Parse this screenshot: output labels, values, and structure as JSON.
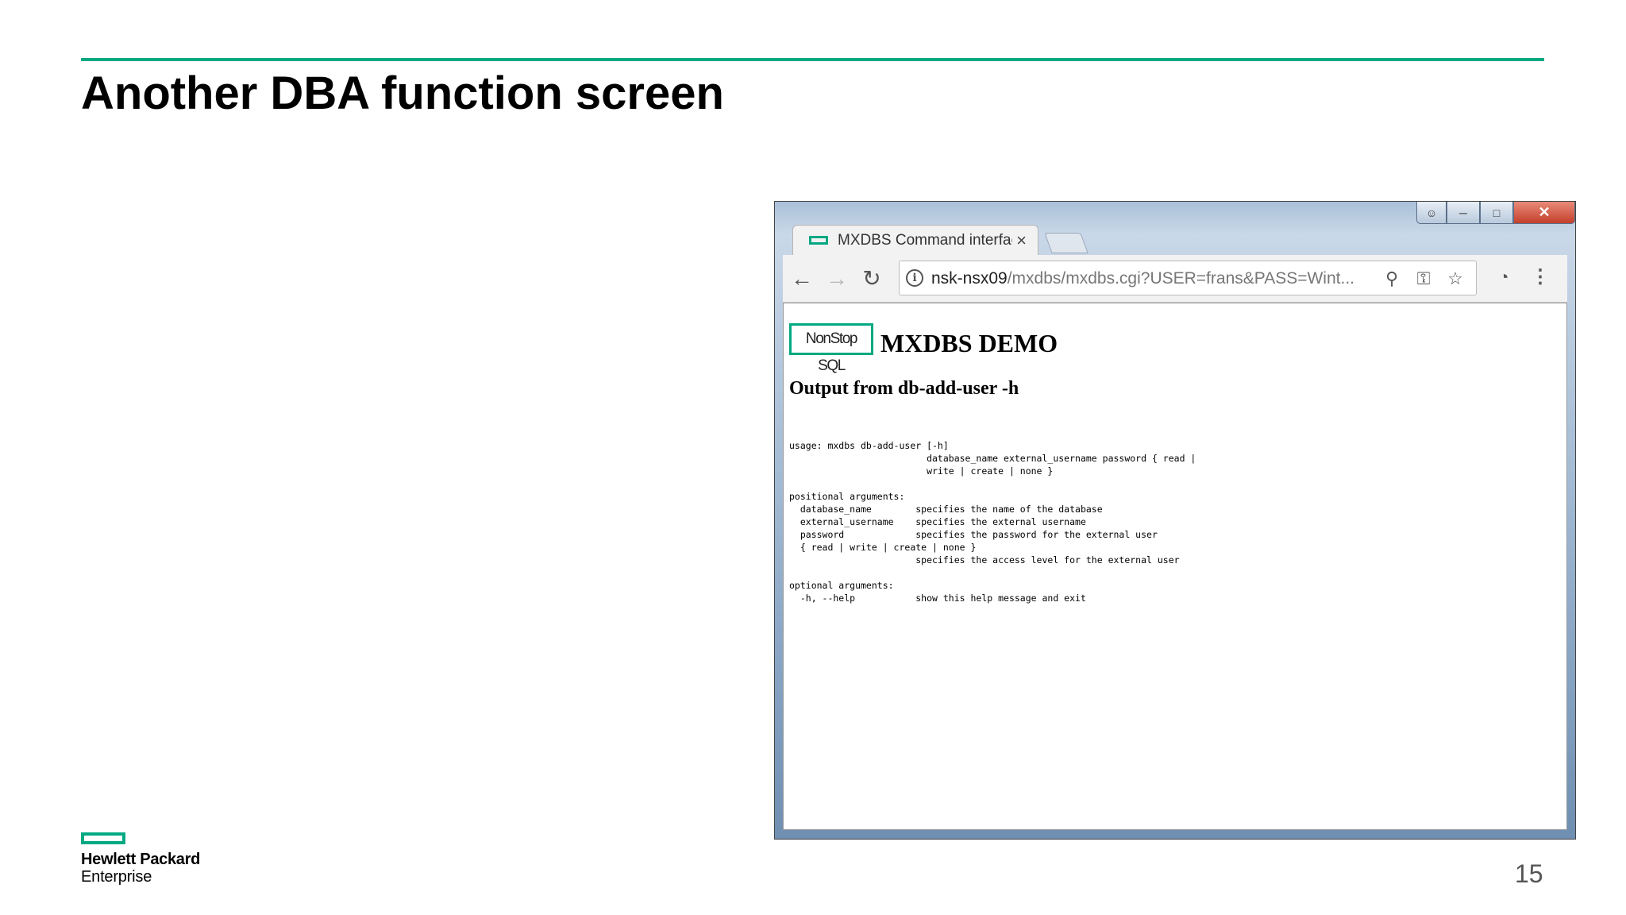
{
  "slide": {
    "title": "Another DBA function screen",
    "page_number": "15",
    "brand": {
      "line1": "Hewlett Packard",
      "line2": "Enterprise"
    },
    "accent_color": "#01a982"
  },
  "browser": {
    "tab": {
      "title": "MXDBS Command interface",
      "close_symbol": "×"
    },
    "url": {
      "host": "nsk-nsx09",
      "path": "/mxdbs/mxdbs.cgi?USER=frans&PASS=Wint..."
    },
    "icons": {
      "back": "back-arrow-icon",
      "forward": "forward-arrow-icon",
      "reload": "reload-icon",
      "info": "info-icon",
      "zoom": "zoom-icon",
      "key": "key-icon",
      "star": "star-icon",
      "performance": "speedometer-icon",
      "menu": "kebab-menu-icon"
    }
  },
  "page": {
    "logo_text": "NonStop SQL",
    "heading": "MXDBS DEMO",
    "subheading": "Output from db-add-user -h",
    "output_lines": [
      "usage: mxdbs db-add-user [-h]",
      "                         database_name external_username password { read |",
      "                         write | create | none }",
      "",
      "positional arguments:",
      "  database_name        specifies the name of the database",
      "  external_username    specifies the external username",
      "  password             specifies the password for the external user",
      "  { read | write | create | none }",
      "                       specifies the access level for the external user",
      "",
      "optional arguments:",
      "  -h, --help           show this help message and exit"
    ]
  }
}
